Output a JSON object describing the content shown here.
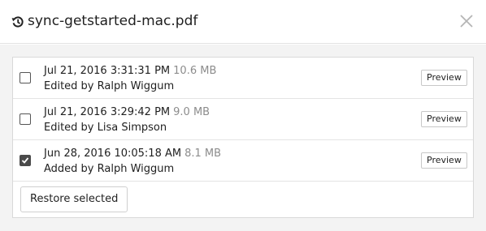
{
  "dialog": {
    "title": "sync-getstarted-mac.pdf",
    "title_icon": "history-icon",
    "close_icon": "close-icon"
  },
  "versions": [
    {
      "date": "Jul 21, 2016 3:31:31 PM",
      "size": "10.6 MB",
      "action": "Edited by Ralph Wiggum",
      "checked": false,
      "preview_label": "Preview"
    },
    {
      "date": "Jul 21, 2016 3:29:42 PM",
      "size": "9.0 MB",
      "action": "Edited by Lisa Simpson",
      "checked": false,
      "preview_label": "Preview"
    },
    {
      "date": "Jun 28, 2016 10:05:18 AM",
      "size": "8.1 MB",
      "action": "Added by Ralph Wiggum",
      "checked": true,
      "preview_label": "Preview"
    }
  ],
  "restore_label": "Restore selected"
}
